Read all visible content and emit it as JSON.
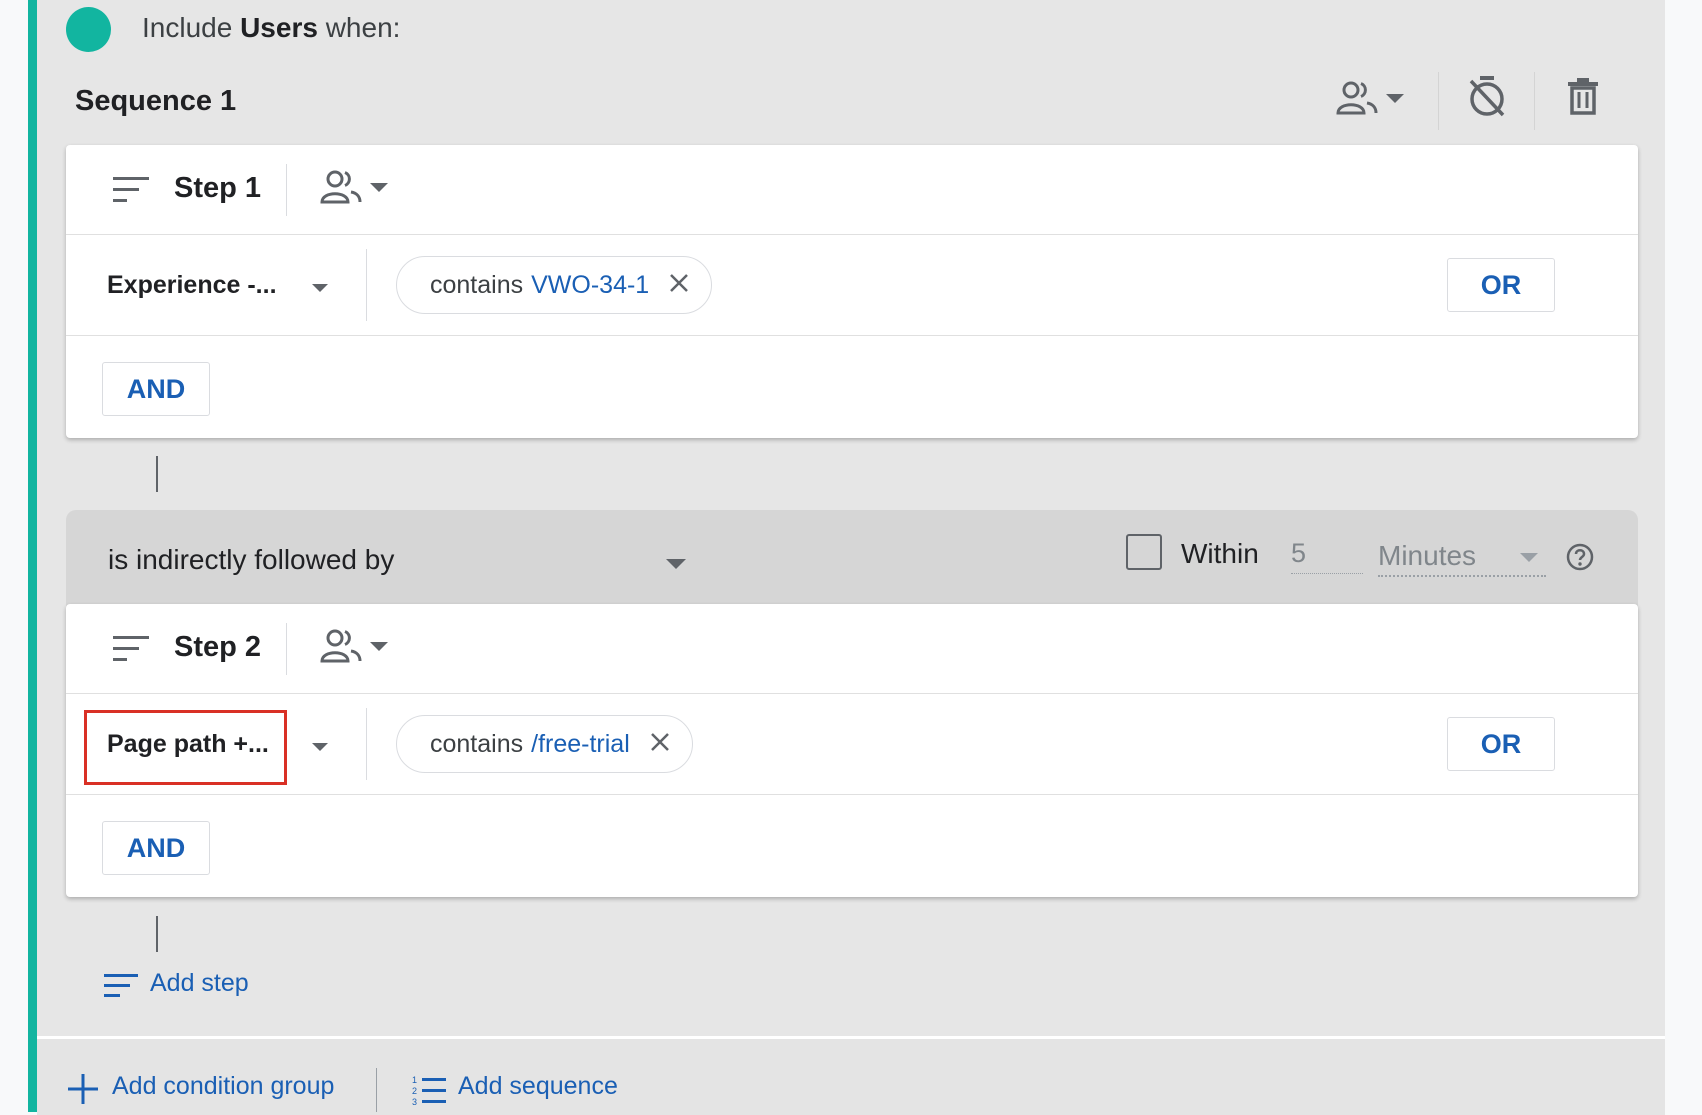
{
  "header": {
    "include_prefix": "Include",
    "include_subject": "Users",
    "include_suffix": "when:"
  },
  "sequence": {
    "title": "Sequence 1",
    "toolbar_icons": [
      "people-icon",
      "chevron-down-icon",
      "timer-off-icon",
      "trash-icon"
    ]
  },
  "steps": [
    {
      "title": "Step 1",
      "dimension": "Experience -...",
      "operator": "contains",
      "value": "VWO-34-1",
      "or_label": "OR",
      "and_label": "AND"
    },
    {
      "title": "Step 2",
      "dimension": "Page path +...",
      "operator": "contains",
      "value": "/free-trial",
      "or_label": "OR",
      "and_label": "AND"
    }
  ],
  "follow": {
    "relation": "is indirectly followed by",
    "within_label": "Within",
    "within_value": "5",
    "within_unit": "Minutes"
  },
  "actions": {
    "add_step": "Add step",
    "add_condition_group": "Add condition group",
    "add_sequence": "Add sequence"
  },
  "colors": {
    "accent": "#12b5a0",
    "link": "#1a5fb4",
    "highlight": "#d93025"
  }
}
